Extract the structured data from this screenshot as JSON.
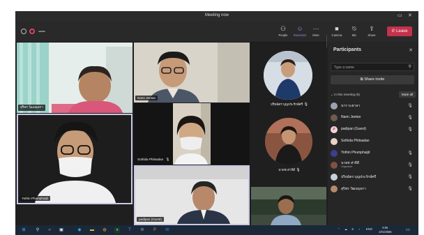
{
  "window": {
    "title": "Meeting now"
  },
  "toolbar": {
    "people_label": "People",
    "reactions_label": "Reactions",
    "more_label": "More",
    "camera_label": "Camera",
    "mic_label": "Mic",
    "share_label": "Share",
    "leave_label": "Leave"
  },
  "tiles": {
    "t1_name": "สุริพร วัฒนธุลกา",
    "t2_name": "Nann Jeetan",
    "t3_name": "ปริยฉัตร บุญประรักษ์ศรี",
    "t4_name": "Yothin Phumphaijit",
    "t5_name": "Sothida Phitsadan",
    "t6_name": "นายช ส่าจีดี",
    "t7_name": "padipan (Guest)"
  },
  "participants": {
    "title": "Participants",
    "search_placeholder": "Type a name",
    "share_invite_label": "Share invite",
    "in_meeting_label": "In this meeting (8)",
    "mute_all_label": "Mute all",
    "list": [
      {
        "name": "นาร ระยาลา",
        "role": ""
      },
      {
        "name": "Nann Jeetan",
        "role": ""
      },
      {
        "name": "padipan (Guest)",
        "role": ""
      },
      {
        "name": "Sothida Phitsadan",
        "role": ""
      },
      {
        "name": "Yothin Phumphaijit",
        "role": ""
      },
      {
        "name": "นายช ส่าจีดี",
        "role": "Organizer"
      },
      {
        "name": "ปริยฉัตร บุญประรักษ์ศรี",
        "role": ""
      },
      {
        "name": "สุริพร วัฒนธุลกา",
        "role": ""
      }
    ]
  },
  "taskbar": {
    "lang": "ENG",
    "time": "9:55",
    "date": "1/01/2565"
  },
  "colors": {
    "leave": "#c4314b",
    "accent": "#8d8fe6",
    "panel_bg": "#262626",
    "stage_bg": "#1f1f1f"
  }
}
